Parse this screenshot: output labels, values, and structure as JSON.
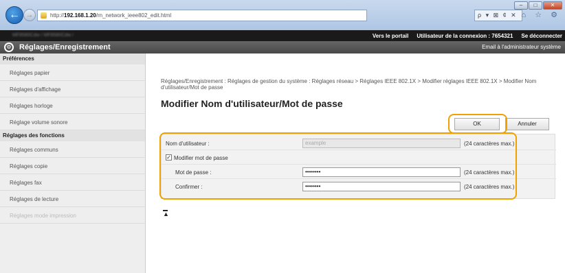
{
  "browser": {
    "url_prefix": "http://",
    "url_host": "192.168.1.20",
    "url_path": "/rn_network_ieee802_edit.html",
    "search_tools": "ρ ▾ ⊠ ¢ ✕",
    "icons": "⌂ ☆ ⚙",
    "window_buttons": [
      "–",
      "□",
      "✕"
    ]
  },
  "topbar": {
    "device_name": "MF8580Cdw / MF8580Cdw /",
    "portal_link": "Vers le portail",
    "login_user_label": "Utilisateur de la connexion :",
    "login_user_value": "7654321",
    "logout_link": "Se déconnecter"
  },
  "header": {
    "title": "Réglages/Enregistrement",
    "email_link": "Email à l'administrateur système"
  },
  "sidebar": {
    "sections": [
      {
        "title": "Préférences",
        "items": [
          "Réglages papier",
          "Réglages d'affichage",
          "Réglages horloge",
          "Réglage volume sonore"
        ]
      },
      {
        "title": "Réglages des fonctions",
        "items": [
          "Réglages communs",
          "Réglages copie",
          "Réglages fax",
          "Réglages de lecture",
          "Réglages mode impression"
        ]
      }
    ]
  },
  "main": {
    "breadcrumb": "Réglages/Enregistrement : Réglages de gestion du système : Réglages réseau > Réglages IEEE 802.1X > Modifier réglages IEEE 802.1X > Modifier Nom d'utilisateur/Mot de passe",
    "title": "Modifier Nom d'utilisateur/Mot de passe",
    "ok_label": "OK",
    "cancel_label": "Annuler",
    "form": {
      "username_label": "Nom d'utilisateur :",
      "username_value": "example",
      "username_hint": "(24 caractères max.)",
      "change_password_label": "Modifier mot de passe",
      "change_password_checked": "✓",
      "password_label": "Mot de passe :",
      "password_value": "••••••••",
      "password_hint": "(24 caractères max.)",
      "confirm_label": "Confirmer :",
      "confirm_value": "••••••••",
      "confirm_hint": "(24 caractères max.)"
    }
  },
  "colors": {
    "highlight": "#f0a100",
    "header_bg": "#555555",
    "topbar_bg": "#1a1a1a"
  }
}
